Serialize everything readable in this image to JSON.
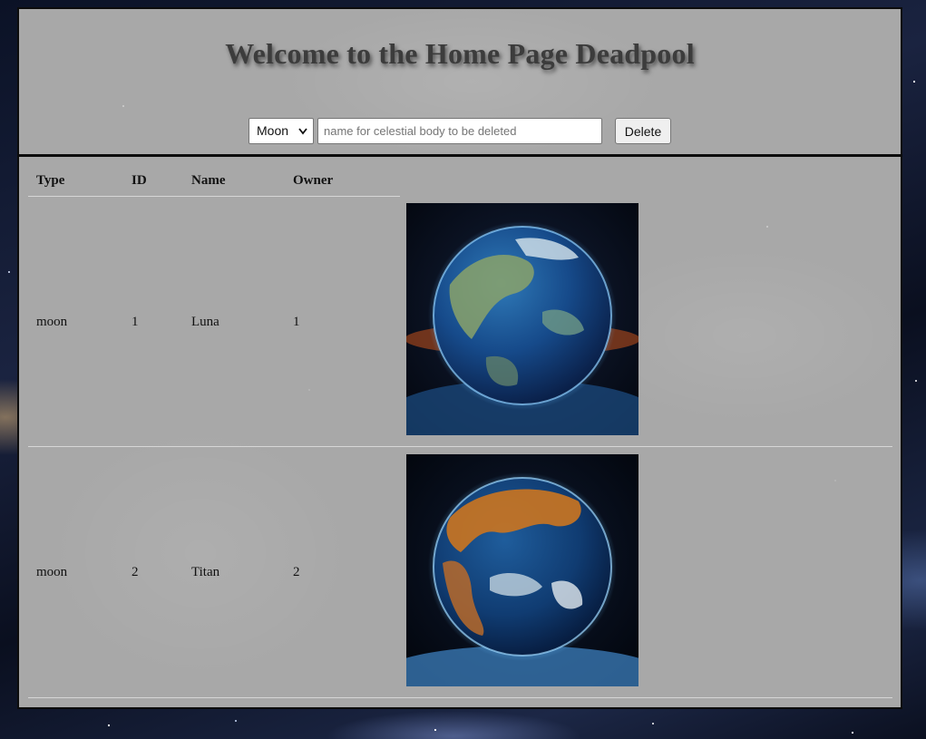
{
  "header": {
    "title": "Welcome to the Home Page Deadpool",
    "type_select": {
      "selected": "Moon",
      "options": [
        "Moon"
      ]
    },
    "name_input": {
      "value": "",
      "placeholder": "name for celestial body to be deleted"
    },
    "delete_label": "Delete"
  },
  "table": {
    "columns": [
      "Type",
      "ID",
      "Name",
      "Owner"
    ],
    "rows": [
      {
        "type": "moon",
        "id": "1",
        "name": "Luna",
        "owner": "1",
        "image": "earth-like-planet-image"
      },
      {
        "type": "moon",
        "id": "2",
        "name": "Titan",
        "owner": "2",
        "image": "orange-blue-planet-image"
      }
    ]
  },
  "colors": {
    "panel_background": "#a8a8a8",
    "panel_border": "#0c0c0c",
    "title_text": "#3c3c3c",
    "row_divider": "#d6d6d6"
  }
}
